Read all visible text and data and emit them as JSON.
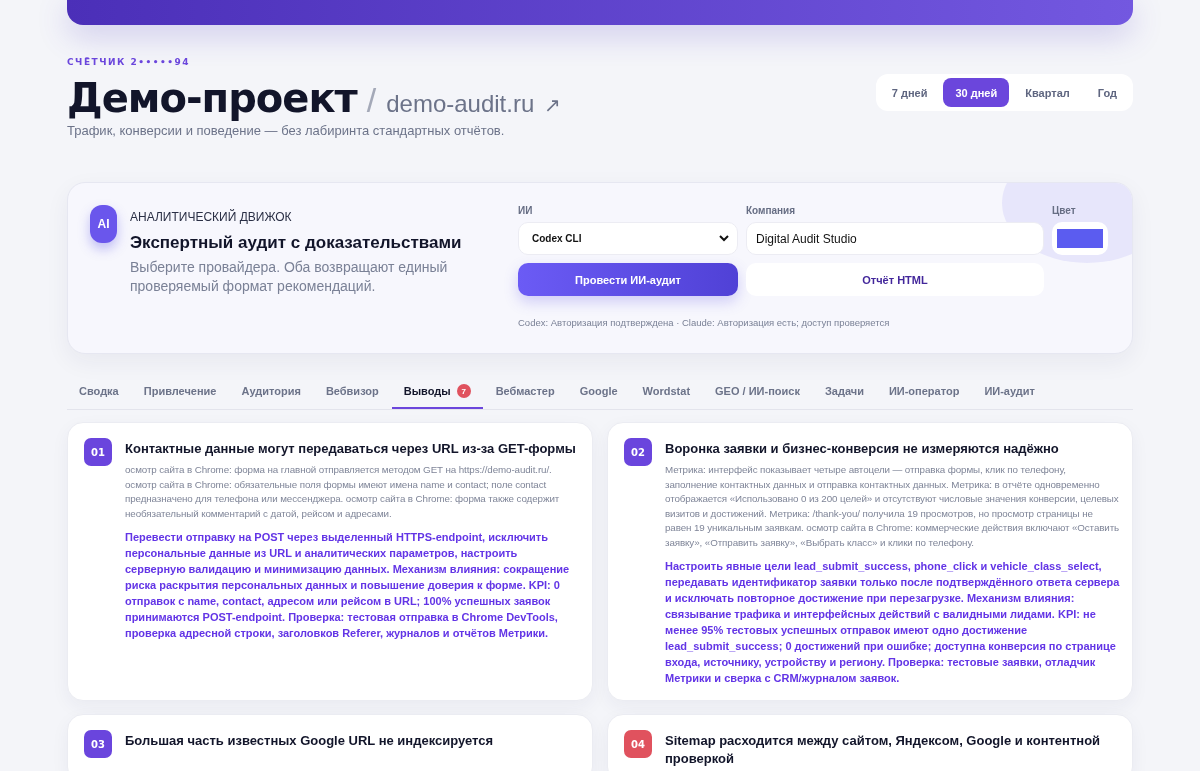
{
  "header": {
    "counter": "СЧЁТЧИК 2•••••94",
    "title": "Демо-проект",
    "separator": "/",
    "domain": "demo-audit.ru",
    "link_icon": "↗",
    "subtitle": "Трафик, конверсии и поведение — без лабиринта стандартных отчётов."
  },
  "periods": [
    {
      "label": "7 дней",
      "selected": false
    },
    {
      "label": "30 дней",
      "selected": true
    },
    {
      "label": "Квартал",
      "selected": false
    },
    {
      "label": "Год",
      "selected": false
    }
  ],
  "ai_panel": {
    "badge": "AI",
    "eyebrow": "АНАЛИТИЧЕСКИЙ ДВИЖОК",
    "title": "Экспертный аудит с доказательствами",
    "description": "Выберите провайдера. Оба возвращают единый проверяемый формат рекомендаций.",
    "provider_label": "ИИ",
    "provider_value": "Codex CLI",
    "company_label": "Компания",
    "company_value": "Digital Audit Studio",
    "color_label": "Цвет",
    "color": "#5b5cf0",
    "run_button": "Провести ИИ-аудит",
    "report_button": "Отчёт HTML",
    "status": "Codex: Авторизация подтверждена · Claude: Авторизация есть; доступ проверяется"
  },
  "tabs": [
    {
      "label": "Сводка",
      "selected": false
    },
    {
      "label": "Привлечение",
      "selected": false
    },
    {
      "label": "Аудитория",
      "selected": false
    },
    {
      "label": "Вебвизор",
      "selected": false
    },
    {
      "label": "Выводы",
      "selected": true,
      "badge": "7"
    },
    {
      "label": "Вебмастер",
      "selected": false
    },
    {
      "label": "Google",
      "selected": false
    },
    {
      "label": "Wordstat",
      "selected": false
    },
    {
      "label": "GEO / ИИ-поиск",
      "selected": false
    },
    {
      "label": "Задачи",
      "selected": false
    },
    {
      "label": "ИИ-оператор",
      "selected": false
    },
    {
      "label": "ИИ-аудит",
      "selected": false
    }
  ],
  "findings": [
    {
      "number": "01",
      "color": "#6a45dd",
      "title": "Контактные данные могут передаваться через URL из-за GET-формы",
      "evidence": "осмотр сайта в Chrome: форма на главной отправляется методом GET на https://demo-audit.ru/. осмотр сайта в Chrome: обязательные поля формы имеют имена name и contact; поле contact предназначено для телефона или мессенджера. осмотр сайта в Chrome: форма также содержит необязательный комментарий с датой, рейсом и адресами.",
      "recommendation": "Перевести отправку на POST через выделенный HTTPS-endpoint, исключить персональные данные из URL и аналитических параметров, настроить серверную валидацию и минимизацию данных. Механизм влияния: сокращение риска раскрытия персональных данных и повышение доверия к форме. KPI: 0 отправок с name, contact, адресом или рейсом в URL; 100% успешных заявок принимаются POST-endpoint. Проверка: тестовая отправка в Chrome DevTools, проверка адресной строки, заголовков Referer, журналов и отчётов Метрики."
    },
    {
      "number": "02",
      "color": "#6a45dd",
      "title": "Воронка заявки и бизнес-конверсия не измеряются надёжно",
      "evidence": "Метрика: интерфейс показывает четыре автоцели — отправка формы, клик по телефону, заполнение контактных данных и отправка контактных данных. Метрика: в отчёте одновременно отображается «Использовано 0 из 200 целей» и отсутствуют числовые значения конверсии, целевых визитов и достижений. Метрика: /thank-you/ получила 19 просмотров, но просмотр страницы не равен 19 уникальным заявкам. осмотр сайта в Chrome: коммерческие действия включают «Оставить заявку», «Отправить заявку», «Выбрать класс» и клики по телефону.",
      "recommendation": "Настроить явные цели lead_submit_success, phone_click и vehicle_class_select, передавать идентификатор заявки только после подтверждённого ответа сервера и исключать повторное достижение при перезагрузке. Механизм влияния: связывание трафика и интерфейсных действий с валидными лидами. KPI: не менее 95% тестовых успешных отправок имеют одно достижение lead_submit_success; 0 достижений при ошибке; доступна конверсия по странице входа, источнику, устройству и региону. Проверка: тестовые заявки, отладчик Метрики и сверка с CRM/журналом заявок."
    },
    {
      "number": "03",
      "color": "#6a45dd",
      "title": "Большая часть известных Google URL не индексируется"
    },
    {
      "number": "04",
      "color": "#e0525e",
      "title": "Sitemap расходится между сайтом, Яндексом, Google и контентной проверкой"
    }
  ]
}
